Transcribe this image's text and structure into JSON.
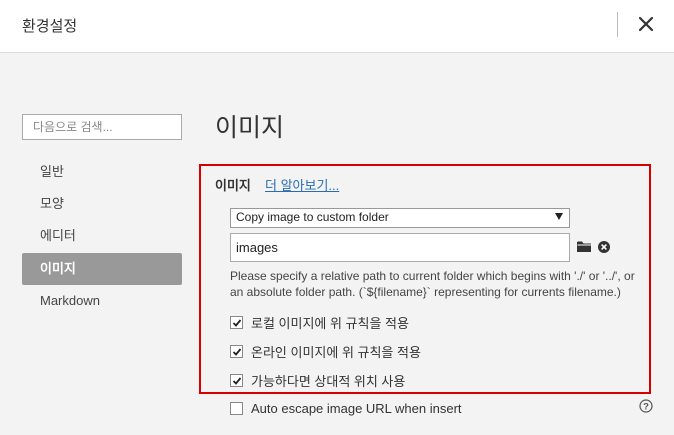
{
  "window": {
    "title": "환경설정"
  },
  "sidebar": {
    "search_placeholder": "다음으로 검색...",
    "items": [
      {
        "label": "일반",
        "active": false
      },
      {
        "label": "모양",
        "active": false
      },
      {
        "label": "에디터",
        "active": false
      },
      {
        "label": "이미지",
        "active": true
      },
      {
        "label": "Markdown",
        "active": false
      }
    ]
  },
  "main": {
    "page_title": "이미지",
    "section": {
      "label": "이미지",
      "learn_more": "더 알아보기...",
      "insert_action": {
        "selected": "Copy image to custom folder"
      },
      "folder": {
        "value": "images"
      },
      "hint": " Please specify a relative path to current folder which begins with './' or '../', or an absolute folder path. (`${filename}` representing for currents filename.)",
      "options": [
        {
          "label": "로컬 이미지에 위 규칙을 적용",
          "checked": true
        },
        {
          "label": "온라인 이미지에 위 규칙을 적용",
          "checked": true
        },
        {
          "label": "가능하다면 상대적 위치 사용",
          "checked": true
        },
        {
          "label": "Auto escape image URL when insert",
          "checked": false
        }
      ]
    }
  },
  "colors": {
    "highlight_border": "#d70000",
    "link": "#2a6db5",
    "active_nav": "#999999"
  },
  "icons": [
    "close-icon",
    "folder-icon",
    "clear-icon",
    "check-icon",
    "help-icon"
  ]
}
